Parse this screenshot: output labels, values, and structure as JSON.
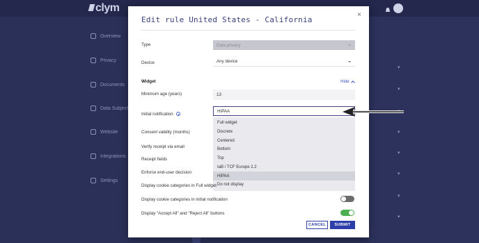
{
  "app": {
    "logo_text": "clym",
    "nav": [
      {
        "icon": "home-icon",
        "label": "Overview"
      },
      {
        "icon": "shield-icon",
        "label": "Privacy"
      },
      {
        "icon": "doc-icon",
        "label": "Documents"
      },
      {
        "icon": "user-icon",
        "label": "Data Subjects"
      },
      {
        "icon": "globe-icon",
        "label": "Website"
      },
      {
        "icon": "cart-icon",
        "label": "Integrations"
      },
      {
        "icon": "gear-icon",
        "label": "Settings"
      }
    ]
  },
  "modal": {
    "title": "Edit rule United States - California",
    "close_label": "×",
    "type_label": "Type",
    "type_value": "Data privacy",
    "device_label": "Device",
    "device_value": "Any device",
    "widget_label": "Widget",
    "hide_label": "Hide",
    "min_age_label": "Minimum age (years)",
    "min_age_value": "13",
    "initial_notification_label": "Initial notification",
    "initial_notification_value": "HIPAA",
    "consent_validity_label": "Consent validity (months)",
    "verify_receipt_label": "Verify receipt via email",
    "receipt_fields_label": "Receipt fields",
    "enforce_label": "Enforce end-user decision",
    "display_full_widget_label": "Display cookie categories in Full widget",
    "display_initial_label": "Display cookie categories in initial notification",
    "display_initial_toggle": false,
    "display_accept_reject_label": "Display \"Accept All\" and \"Reject All\" buttons",
    "display_accept_reject_toggle": true,
    "cancel_label": "CANCEL",
    "submit_label": "SUBMIT"
  },
  "dropdown": {
    "options": [
      "Full widget",
      "Discrete",
      "Centered",
      "Bottom",
      "Top",
      "IaB / TCF Europe 2.2",
      "HIPAA",
      "Do not display"
    ],
    "selected": "HIPAA"
  },
  "colors": {
    "accent": "#2d3ea8",
    "title": "#3a3f7a",
    "toggle_on": "#4caf50",
    "toggle_off": "#6c6c6c",
    "backdrop": "#2a2f57"
  }
}
